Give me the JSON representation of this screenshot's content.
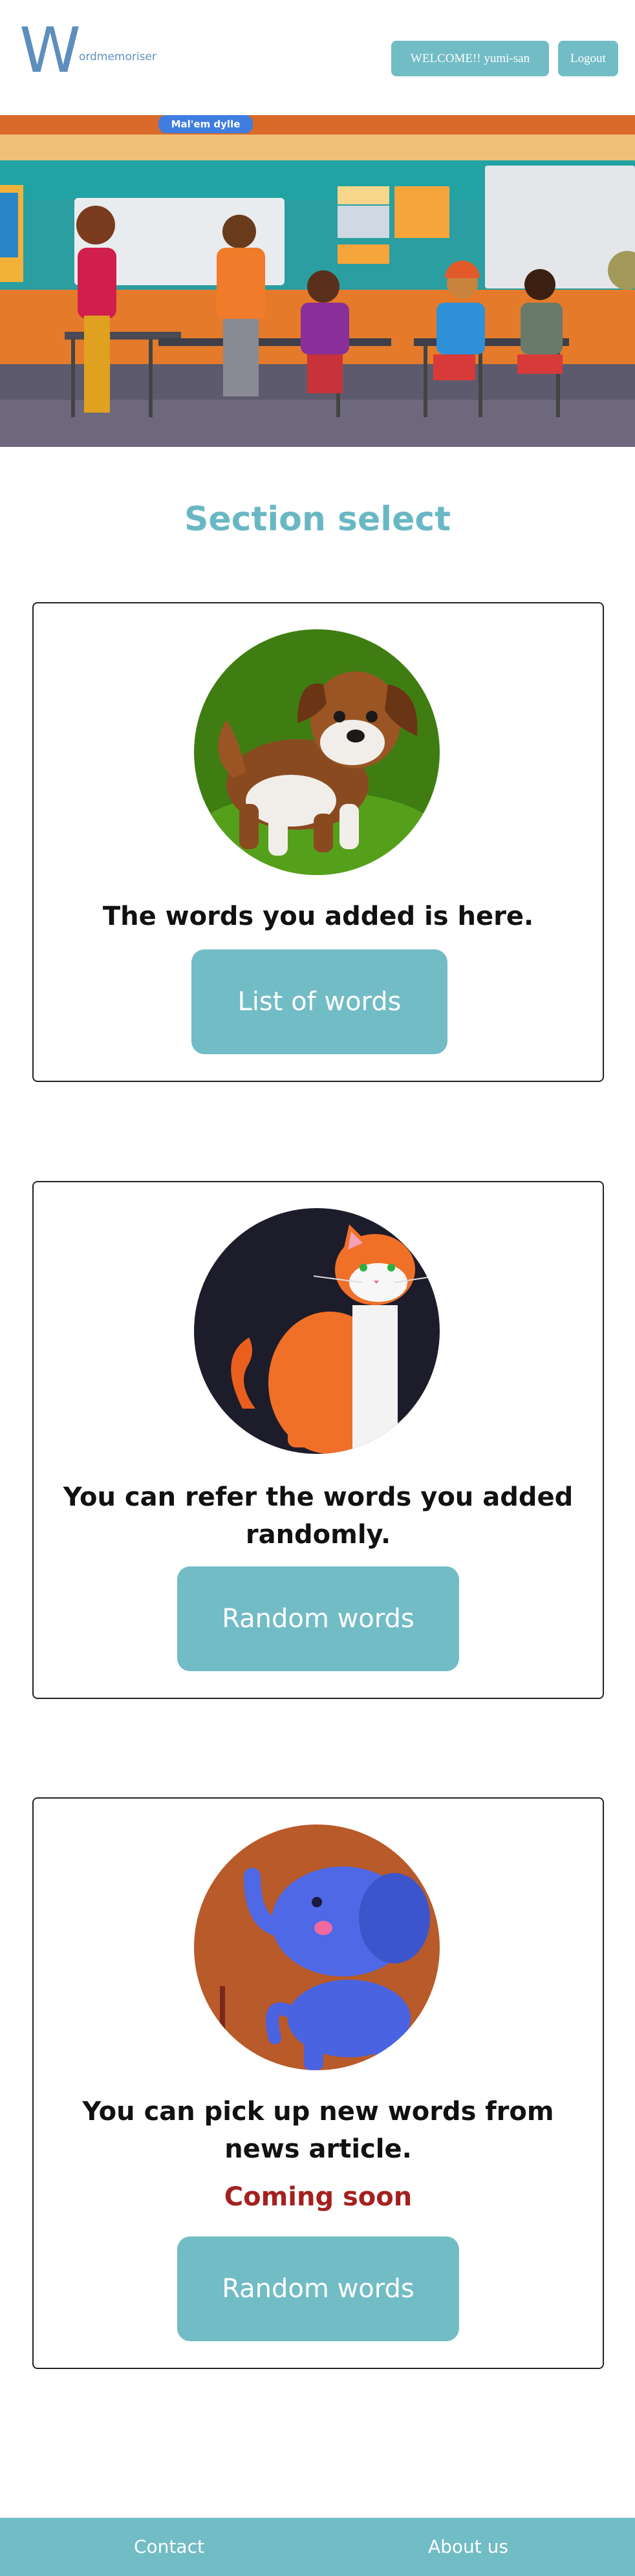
{
  "header": {
    "logo_letter": "W",
    "logo_rest": "ordmemoriser",
    "welcome_label": "WELCOME!! yumi-san",
    "logout_label": "Logout"
  },
  "hero": {
    "banner_text": "Mal'em dylle"
  },
  "section_title": "Section select",
  "cards": [
    {
      "text": "The words you added is here.",
      "button": "List of words"
    },
    {
      "text": "You can refer the words you added randomly.",
      "button": "Random words"
    },
    {
      "text": "You can pick up new words from news article.",
      "status": "Coming soon",
      "button": "Random words"
    }
  ],
  "footer": {
    "contact": "Contact",
    "about": "About us"
  },
  "colors": {
    "accent": "#72bcc6",
    "title": "#6ab7c4",
    "logo": "#5d8fbd",
    "coming_soon": "#a5201e"
  }
}
